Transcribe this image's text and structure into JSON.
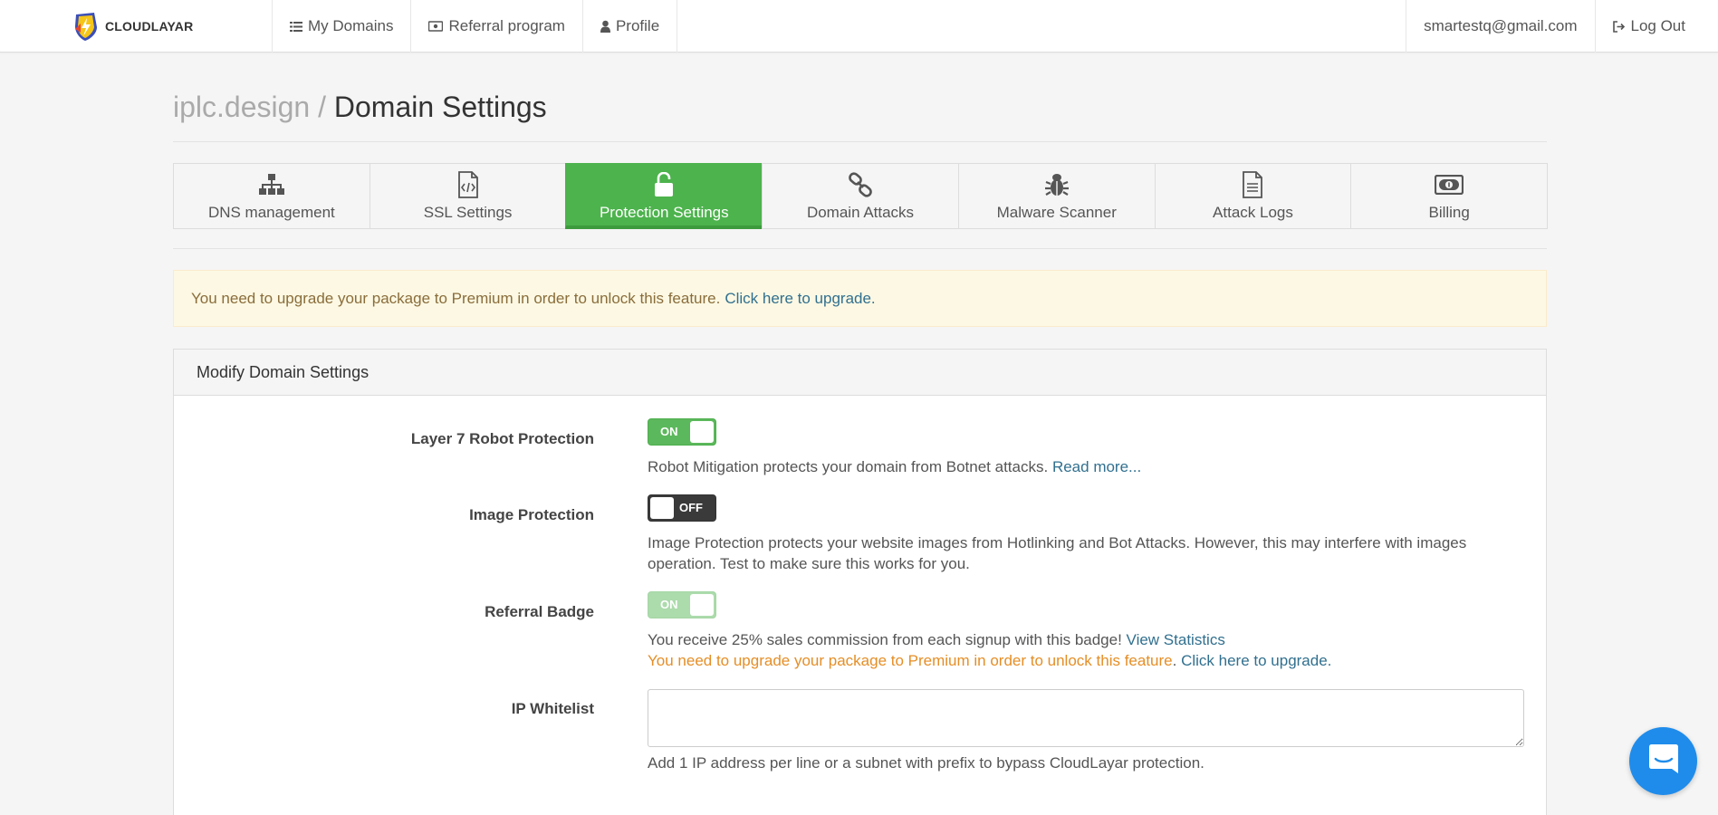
{
  "brand": {
    "name": "CLOUDLAYAR"
  },
  "nav": {
    "left": [
      {
        "label": "My Domains",
        "icon": "list-icon"
      },
      {
        "label": "Referral program",
        "icon": "money-icon"
      },
      {
        "label": "Profile",
        "icon": "user-icon"
      }
    ],
    "email": "smartestq@gmail.com",
    "logout": "Log Out"
  },
  "page": {
    "crumb": "iplc.design /",
    "title": "Domain Settings"
  },
  "tabs": [
    {
      "label": "DNS management",
      "icon": "sitemap-icon"
    },
    {
      "label": "SSL Settings",
      "icon": "code-file-icon"
    },
    {
      "label": "Protection Settings",
      "icon": "unlock-icon",
      "active": true
    },
    {
      "label": "Domain Attacks",
      "icon": "link-icon"
    },
    {
      "label": "Malware Scanner",
      "icon": "bug-icon"
    },
    {
      "label": "Attack Logs",
      "icon": "file-text-icon"
    },
    {
      "label": "Billing",
      "icon": "money-bill-icon"
    }
  ],
  "alert": {
    "text": "You need to upgrade your package to Premium in order to unlock this feature.",
    "link": "Click here to upgrade."
  },
  "panel": {
    "heading": "Modify Domain Settings",
    "robot": {
      "label": "Layer 7 Robot Protection",
      "state": "ON",
      "help": "Robot Mitigation protects your domain from Botnet attacks.",
      "link": "Read more..."
    },
    "image": {
      "label": "Image Protection",
      "state": "OFF",
      "help": "Image Protection protects your website images from Hotlinking and Bot Attacks. However, this may interfere with images operation. Test to make sure this works for you."
    },
    "referral": {
      "label": "Referral Badge",
      "state": "ON",
      "help": "You receive 25% sales commission from each signup with this badge!",
      "link": "View Statistics",
      "warn": "You need to upgrade your package to Premium in order to unlock this feature",
      "warn_link": "Click here to upgrade."
    },
    "whitelist": {
      "label": "IP Whitelist",
      "value": "",
      "help": "Add 1 IP address per line or a subnet with prefix to bypass CloudLayar protection."
    }
  },
  "colors": {
    "accent": "#4db34d",
    "link": "#31708f",
    "warning": "#e58e26",
    "chat": "#1f8ceb"
  }
}
